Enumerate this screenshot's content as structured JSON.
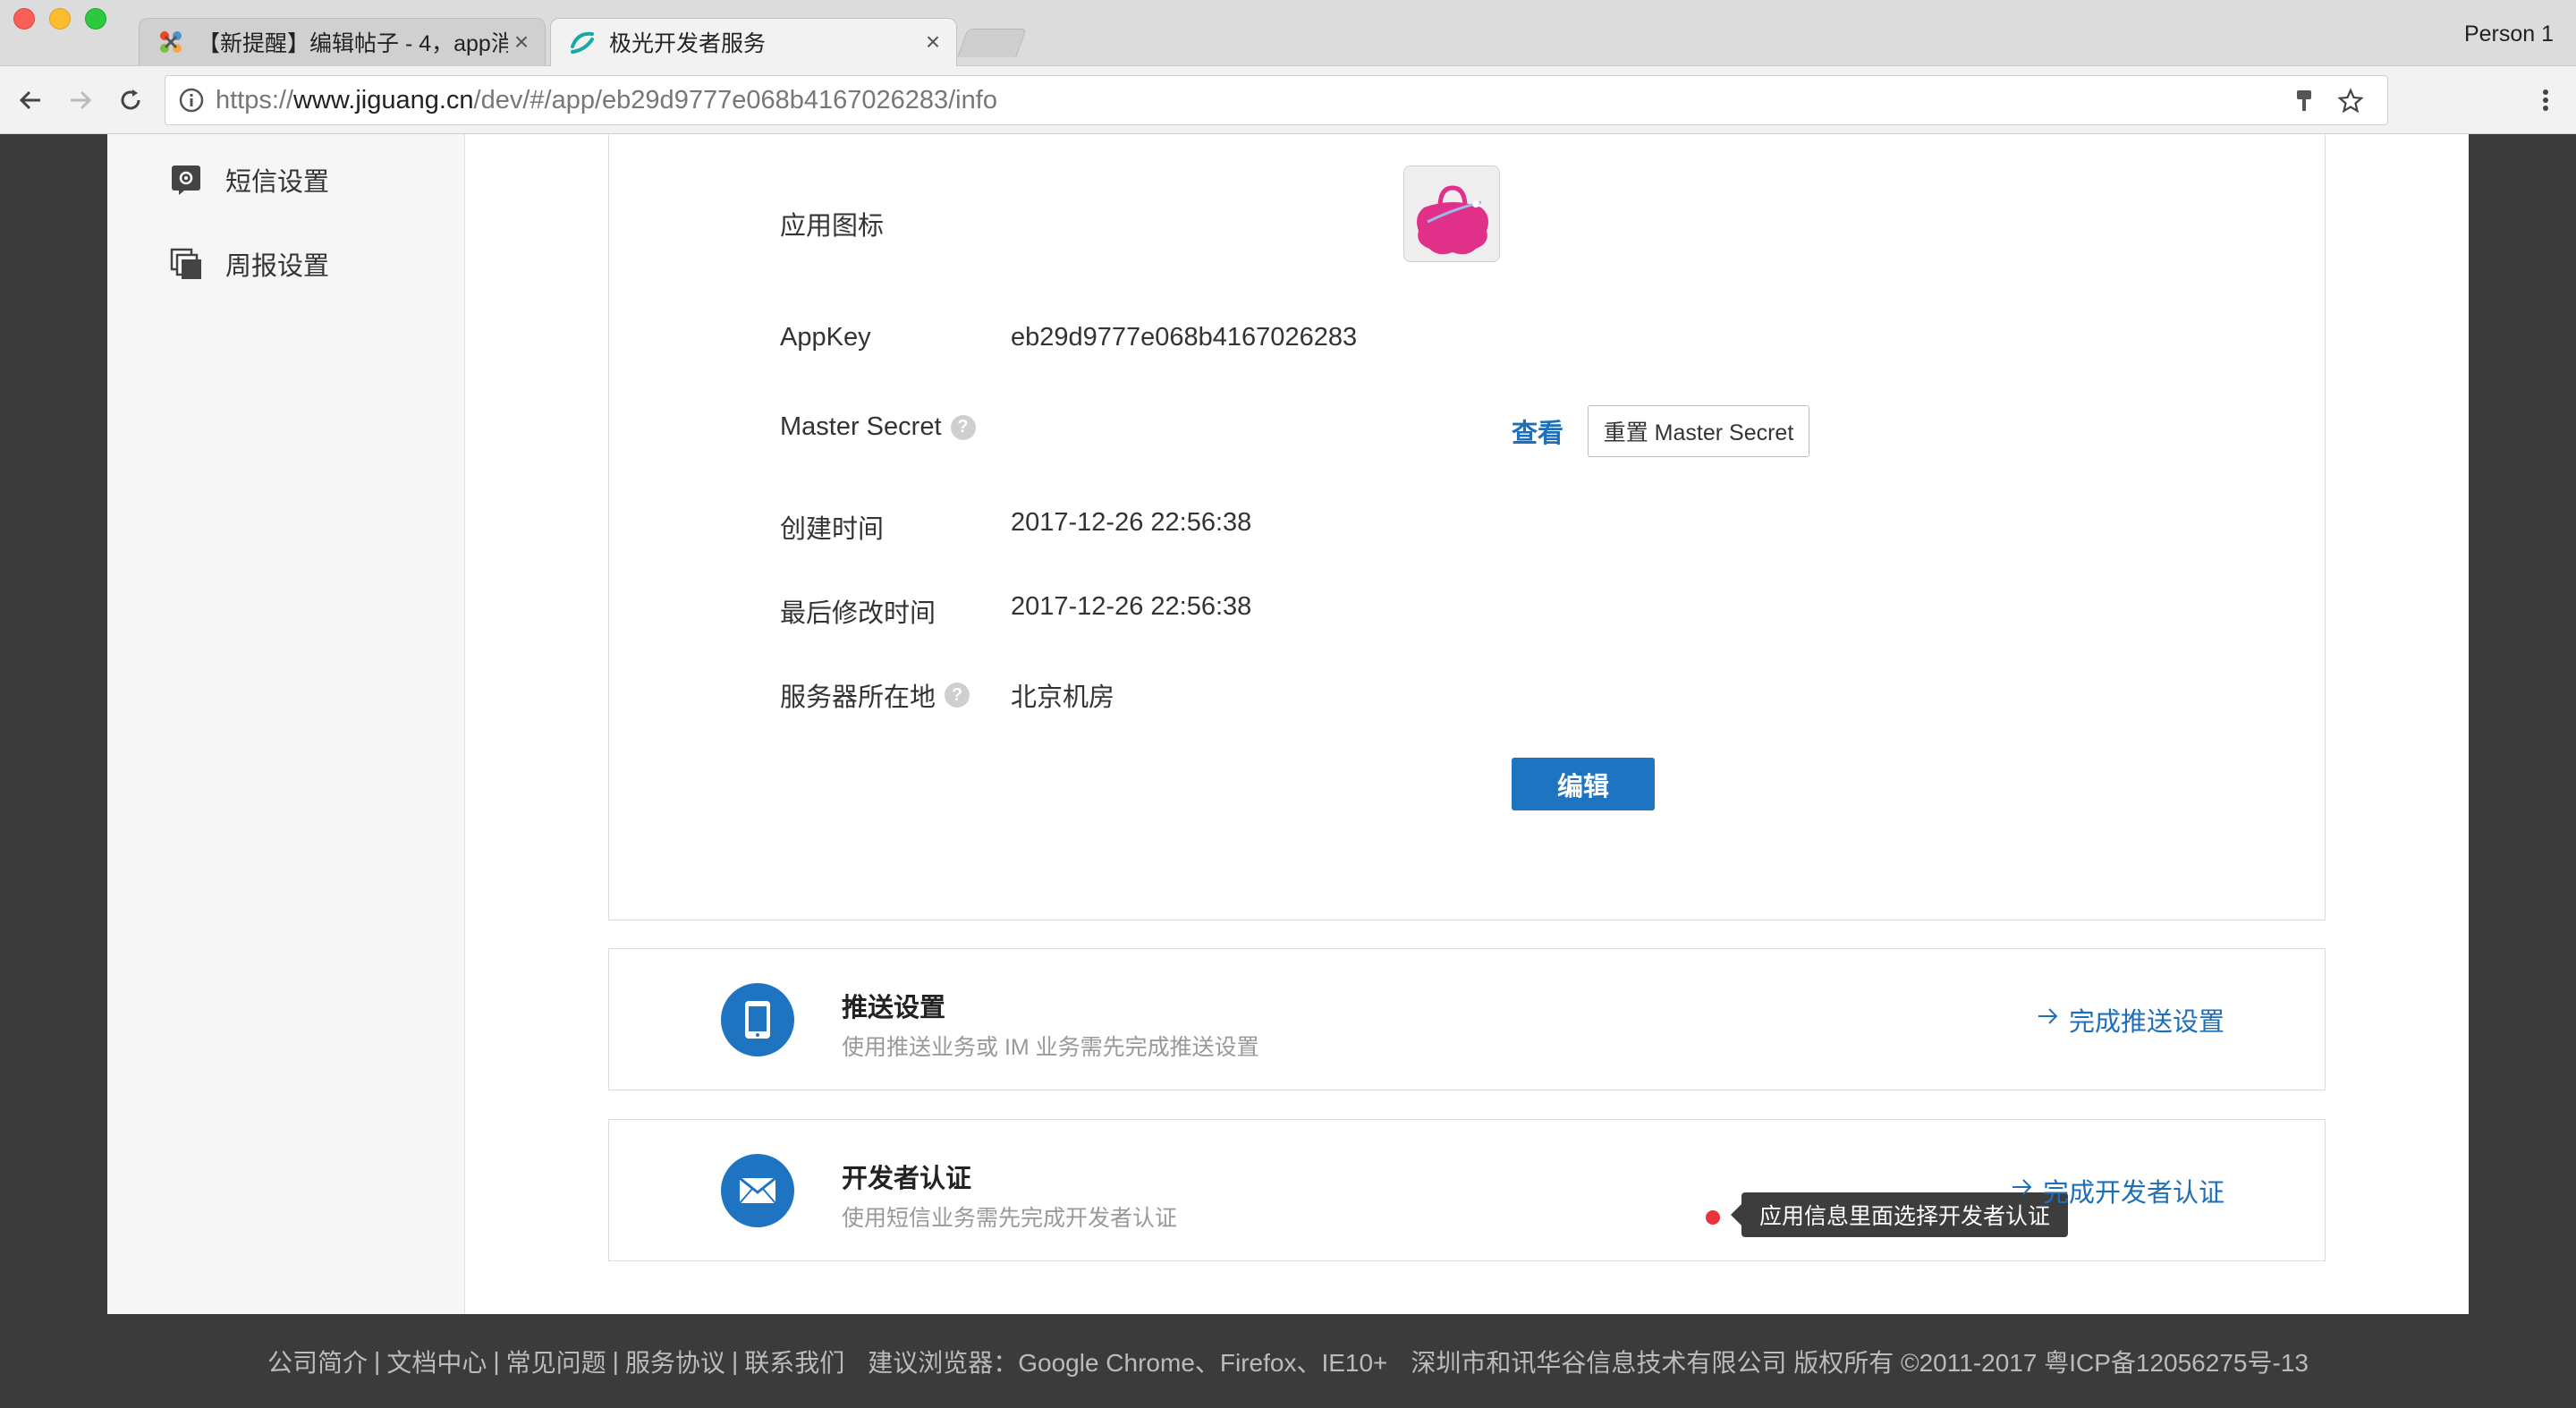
{
  "browser": {
    "tabs": [
      {
        "title": "【新提醒】编辑帖子 - 4，app消",
        "active": false,
        "icon": "joomla-logo-icon"
      },
      {
        "title": "极光开发者服务",
        "active": true,
        "icon": "jiguang-logo-icon"
      }
    ],
    "profile": "Person 1",
    "url": {
      "scheme": "https://",
      "host": "www.jiguang.cn",
      "path": "/dev/#/app/eb29d9777e068b4167026283/info"
    }
  },
  "sidebar": {
    "items": [
      {
        "label": "短信设置",
        "icon": "sms-settings-icon"
      },
      {
        "label": "周报设置",
        "icon": "report-settings-icon"
      }
    ]
  },
  "app_info": {
    "icon_label": "应用图标",
    "appkey_label": "AppKey",
    "appkey_value": "eb29d9777e068b4167026283",
    "master_secret_label": "Master Secret",
    "view_link": "查看",
    "reset_button": "重置 Master Secret",
    "created_label": "创建时间",
    "created_value": "2017-12-26 22:56:38",
    "modified_label": "最后修改时间",
    "modified_value": "2017-12-26 22:56:38",
    "server_label": "服务器所在地",
    "server_value": "北京机房",
    "help_glyph": "?",
    "edit_button": "编辑"
  },
  "cards": {
    "push": {
      "title": "推送设置",
      "desc": "使用推送业务或 IM 业务需先完成推送设置",
      "link": "完成推送设置",
      "icon": "phone-icon"
    },
    "dev": {
      "title": "开发者认证",
      "desc": "使用短信业务需先完成开发者认证",
      "link": "完成开发者认证",
      "icon": "envelope-icon",
      "tooltip": "应用信息里面选择开发者认证"
    }
  },
  "footer": {
    "links": [
      "公司简介",
      "文档中心",
      "常见问题",
      "服务协议",
      "联系我们"
    ],
    "browsers": "建议浏览器：Google Chrome、Firefox、IE10+",
    "copyright": "深圳市和讯华谷信息技术有限公司 版权所有 ©2011-2017 粤ICP备12056275号-13"
  },
  "colors": {
    "accent": "#1f74c1",
    "link": "#1f6fb8",
    "alert_dot": "#e8353b",
    "footer_bg": "#3b3b3b"
  }
}
